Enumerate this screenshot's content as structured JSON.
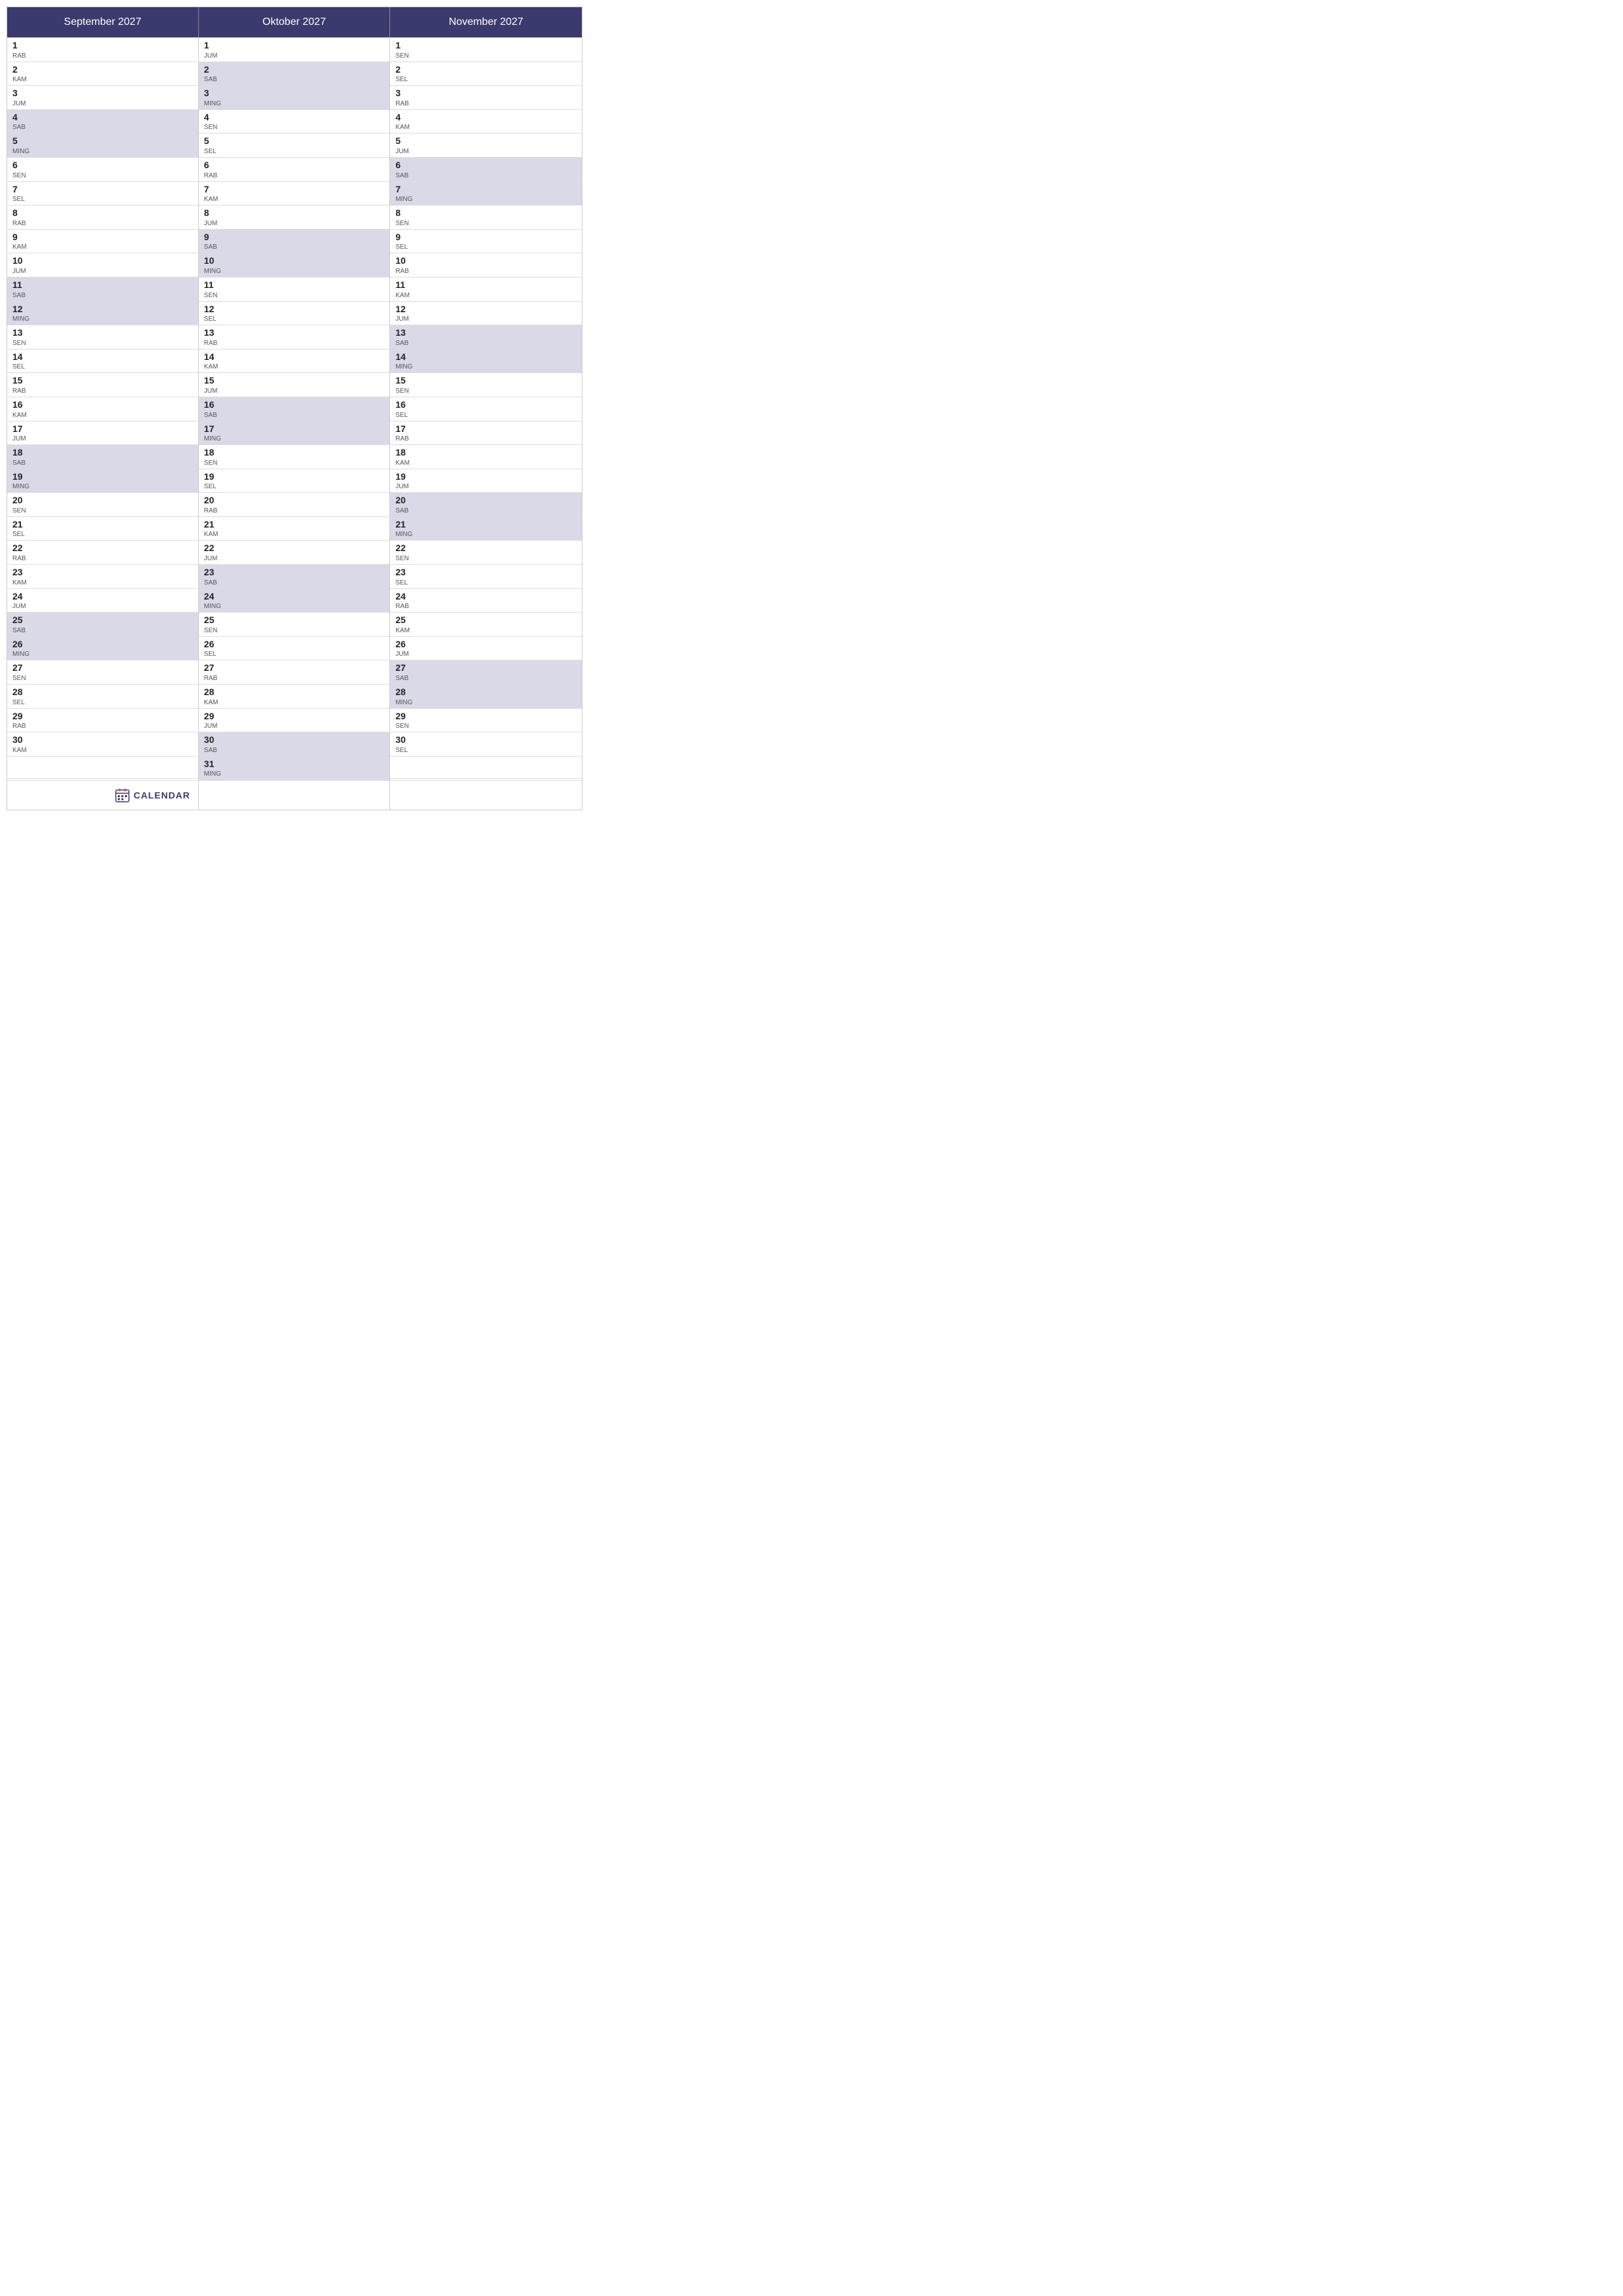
{
  "title": "CALENDAR",
  "months": [
    {
      "name": "September 2027",
      "days": [
        {
          "num": "1",
          "day": "RAB",
          "highlight": false
        },
        {
          "num": "2",
          "day": "KAM",
          "highlight": false
        },
        {
          "num": "3",
          "day": "JUM",
          "highlight": false
        },
        {
          "num": "4",
          "day": "SAB",
          "highlight": true
        },
        {
          "num": "5",
          "day": "MING",
          "highlight": true
        },
        {
          "num": "6",
          "day": "SEN",
          "highlight": false
        },
        {
          "num": "7",
          "day": "SEL",
          "highlight": false
        },
        {
          "num": "8",
          "day": "RAB",
          "highlight": false
        },
        {
          "num": "9",
          "day": "KAM",
          "highlight": false
        },
        {
          "num": "10",
          "day": "JUM",
          "highlight": false
        },
        {
          "num": "11",
          "day": "SAB",
          "highlight": true
        },
        {
          "num": "12",
          "day": "MING",
          "highlight": true
        },
        {
          "num": "13",
          "day": "SEN",
          "highlight": false
        },
        {
          "num": "14",
          "day": "SEL",
          "highlight": false
        },
        {
          "num": "15",
          "day": "RAB",
          "highlight": false
        },
        {
          "num": "16",
          "day": "KAM",
          "highlight": false
        },
        {
          "num": "17",
          "day": "JUM",
          "highlight": false
        },
        {
          "num": "18",
          "day": "SAB",
          "highlight": true
        },
        {
          "num": "19",
          "day": "MING",
          "highlight": true
        },
        {
          "num": "20",
          "day": "SEN",
          "highlight": false
        },
        {
          "num": "21",
          "day": "SEL",
          "highlight": false
        },
        {
          "num": "22",
          "day": "RAB",
          "highlight": false
        },
        {
          "num": "23",
          "day": "KAM",
          "highlight": false
        },
        {
          "num": "24",
          "day": "JUM",
          "highlight": false
        },
        {
          "num": "25",
          "day": "SAB",
          "highlight": true
        },
        {
          "num": "26",
          "day": "MING",
          "highlight": true
        },
        {
          "num": "27",
          "day": "SEN",
          "highlight": false
        },
        {
          "num": "28",
          "day": "SEL",
          "highlight": false
        },
        {
          "num": "29",
          "day": "RAB",
          "highlight": false
        },
        {
          "num": "30",
          "day": "KAM",
          "highlight": false
        }
      ]
    },
    {
      "name": "Oktober 2027",
      "days": [
        {
          "num": "1",
          "day": "JUM",
          "highlight": false
        },
        {
          "num": "2",
          "day": "SAB",
          "highlight": true
        },
        {
          "num": "3",
          "day": "MING",
          "highlight": true
        },
        {
          "num": "4",
          "day": "SEN",
          "highlight": false
        },
        {
          "num": "5",
          "day": "SEL",
          "highlight": false
        },
        {
          "num": "6",
          "day": "RAB",
          "highlight": false
        },
        {
          "num": "7",
          "day": "KAM",
          "highlight": false
        },
        {
          "num": "8",
          "day": "JUM",
          "highlight": false
        },
        {
          "num": "9",
          "day": "SAB",
          "highlight": true
        },
        {
          "num": "10",
          "day": "MING",
          "highlight": true
        },
        {
          "num": "11",
          "day": "SEN",
          "highlight": false
        },
        {
          "num": "12",
          "day": "SEL",
          "highlight": false
        },
        {
          "num": "13",
          "day": "RAB",
          "highlight": false
        },
        {
          "num": "14",
          "day": "KAM",
          "highlight": false
        },
        {
          "num": "15",
          "day": "JUM",
          "highlight": false
        },
        {
          "num": "16",
          "day": "SAB",
          "highlight": true
        },
        {
          "num": "17",
          "day": "MING",
          "highlight": true
        },
        {
          "num": "18",
          "day": "SEN",
          "highlight": false
        },
        {
          "num": "19",
          "day": "SEL",
          "highlight": false
        },
        {
          "num": "20",
          "day": "RAB",
          "highlight": false
        },
        {
          "num": "21",
          "day": "KAM",
          "highlight": false
        },
        {
          "num": "22",
          "day": "JUM",
          "highlight": false
        },
        {
          "num": "23",
          "day": "SAB",
          "highlight": true
        },
        {
          "num": "24",
          "day": "MING",
          "highlight": true
        },
        {
          "num": "25",
          "day": "SEN",
          "highlight": false
        },
        {
          "num": "26",
          "day": "SEL",
          "highlight": false
        },
        {
          "num": "27",
          "day": "RAB",
          "highlight": false
        },
        {
          "num": "28",
          "day": "KAM",
          "highlight": false
        },
        {
          "num": "29",
          "day": "JUM",
          "highlight": false
        },
        {
          "num": "30",
          "day": "SAB",
          "highlight": true
        },
        {
          "num": "31",
          "day": "MING",
          "highlight": true
        }
      ]
    },
    {
      "name": "November 2027",
      "days": [
        {
          "num": "1",
          "day": "SEN",
          "highlight": false
        },
        {
          "num": "2",
          "day": "SEL",
          "highlight": false
        },
        {
          "num": "3",
          "day": "RAB",
          "highlight": false
        },
        {
          "num": "4",
          "day": "KAM",
          "highlight": false
        },
        {
          "num": "5",
          "day": "JUM",
          "highlight": false
        },
        {
          "num": "6",
          "day": "SAB",
          "highlight": true
        },
        {
          "num": "7",
          "day": "MING",
          "highlight": true
        },
        {
          "num": "8",
          "day": "SEN",
          "highlight": false
        },
        {
          "num": "9",
          "day": "SEL",
          "highlight": false
        },
        {
          "num": "10",
          "day": "RAB",
          "highlight": false
        },
        {
          "num": "11",
          "day": "KAM",
          "highlight": false
        },
        {
          "num": "12",
          "day": "JUM",
          "highlight": false
        },
        {
          "num": "13",
          "day": "SAB",
          "highlight": true
        },
        {
          "num": "14",
          "day": "MING",
          "highlight": true
        },
        {
          "num": "15",
          "day": "SEN",
          "highlight": false
        },
        {
          "num": "16",
          "day": "SEL",
          "highlight": false
        },
        {
          "num": "17",
          "day": "RAB",
          "highlight": false
        },
        {
          "num": "18",
          "day": "KAM",
          "highlight": false
        },
        {
          "num": "19",
          "day": "JUM",
          "highlight": false
        },
        {
          "num": "20",
          "day": "SAB",
          "highlight": true
        },
        {
          "num": "21",
          "day": "MING",
          "highlight": true
        },
        {
          "num": "22",
          "day": "SEN",
          "highlight": false
        },
        {
          "num": "23",
          "day": "SEL",
          "highlight": false
        },
        {
          "num": "24",
          "day": "RAB",
          "highlight": false
        },
        {
          "num": "25",
          "day": "KAM",
          "highlight": false
        },
        {
          "num": "26",
          "day": "JUM",
          "highlight": false
        },
        {
          "num": "27",
          "day": "SAB",
          "highlight": true
        },
        {
          "num": "28",
          "day": "MING",
          "highlight": true
        },
        {
          "num": "29",
          "day": "SEN",
          "highlight": false
        },
        {
          "num": "30",
          "day": "SEL",
          "highlight": false
        }
      ]
    }
  ],
  "brand": {
    "icon": "calendar-icon",
    "label": "CALENDAR"
  },
  "colors": {
    "header_bg": "#3b3a6e",
    "header_text": "#ffffff",
    "highlight_bg": "#d9d9e8",
    "border": "#cccccc",
    "day_num": "#222222",
    "day_name": "#555555"
  }
}
